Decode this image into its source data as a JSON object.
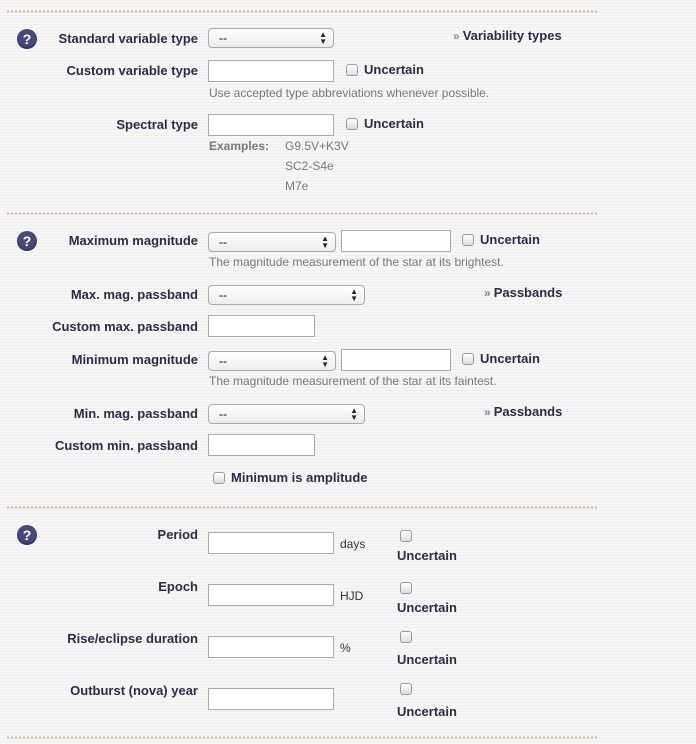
{
  "section1": {
    "std_var_label": "Standard variable type",
    "std_var_value": "--",
    "variability_link": "Variability types",
    "custom_var_label": "Custom variable type",
    "custom_var_uncertain": "Uncertain",
    "custom_var_hint": "Use accepted type abbreviations whenever possible.",
    "spectral_label": "Spectral type",
    "spectral_uncertain": "Uncertain",
    "examples_label": "Examples:",
    "examples": [
      "G9.5V+K3V",
      "SC2-S4e",
      "M7e"
    ]
  },
  "section2": {
    "max_mag_label": "Maximum magnitude",
    "max_mag_select": "--",
    "max_mag_uncertain": "Uncertain",
    "max_mag_hint": "The magnitude measurement of the star at its brightest.",
    "max_pass_label": "Max. mag. passband",
    "max_pass_select": "--",
    "passbands_link_1": "Passbands",
    "custom_max_label": "Custom max. passband",
    "min_mag_label": "Minimum magnitude",
    "min_mag_select": "--",
    "min_mag_uncertain": "Uncertain",
    "min_mag_hint": "The magnitude measurement of the star at its faintest.",
    "min_pass_label": "Min. mag. passband",
    "min_pass_select": "--",
    "passbands_link_2": "Passbands",
    "custom_min_label": "Custom min. passband",
    "min_amplitude_label": "Minimum is amplitude"
  },
  "section3": {
    "period_label": "Period",
    "period_unit": "days",
    "period_uncertain": "Uncertain",
    "epoch_label": "Epoch",
    "epoch_unit": "HJD",
    "epoch_uncertain": "Uncertain",
    "rise_label": "Rise/eclipse duration",
    "rise_unit": "%",
    "rise_uncertain": "Uncertain",
    "outburst_label": "Outburst (nova) year",
    "outburst_uncertain": "Uncertain"
  },
  "icons": {
    "help": "help-icon",
    "chevron": "double-chevron-right-icon",
    "select_arrows": "up-down-arrows-icon"
  },
  "colors": {
    "label": "#2d2a4a",
    "help_bg": "#4a4a78",
    "hint": "#777777"
  },
  "help_glyph": "?",
  "chevron_glyph": "»"
}
